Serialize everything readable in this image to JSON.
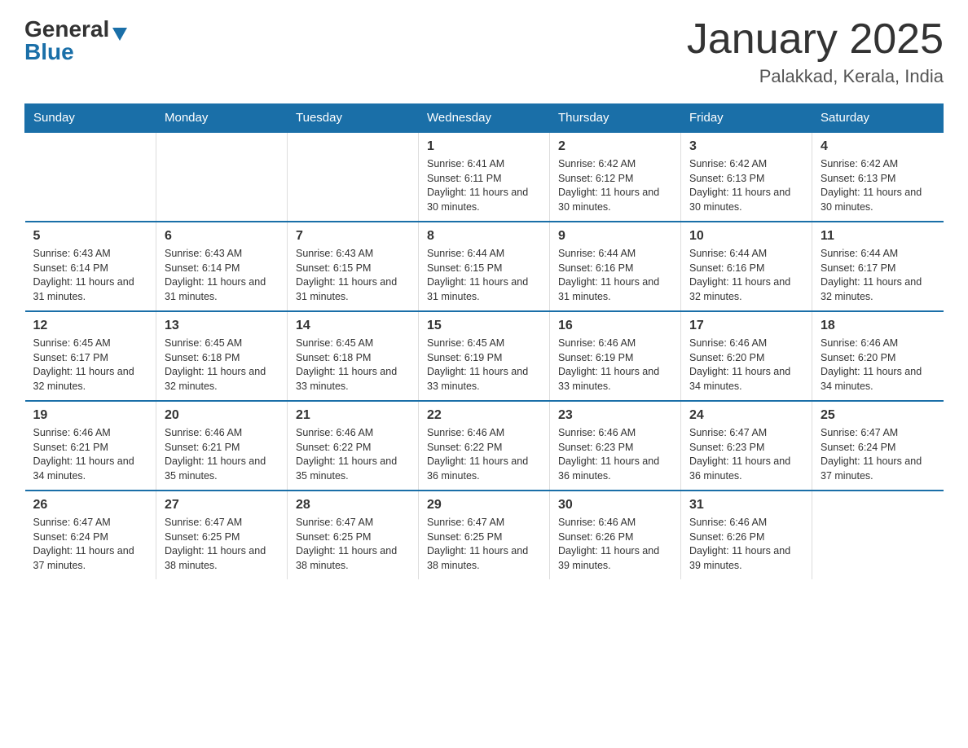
{
  "header": {
    "logo_general": "General",
    "logo_blue": "Blue",
    "title": "January 2025",
    "subtitle": "Palakkad, Kerala, India"
  },
  "days_of_week": [
    "Sunday",
    "Monday",
    "Tuesday",
    "Wednesday",
    "Thursday",
    "Friday",
    "Saturday"
  ],
  "weeks": [
    [
      {
        "day": "",
        "info": ""
      },
      {
        "day": "",
        "info": ""
      },
      {
        "day": "",
        "info": ""
      },
      {
        "day": "1",
        "info": "Sunrise: 6:41 AM\nSunset: 6:11 PM\nDaylight: 11 hours and 30 minutes."
      },
      {
        "day": "2",
        "info": "Sunrise: 6:42 AM\nSunset: 6:12 PM\nDaylight: 11 hours and 30 minutes."
      },
      {
        "day": "3",
        "info": "Sunrise: 6:42 AM\nSunset: 6:13 PM\nDaylight: 11 hours and 30 minutes."
      },
      {
        "day": "4",
        "info": "Sunrise: 6:42 AM\nSunset: 6:13 PM\nDaylight: 11 hours and 30 minutes."
      }
    ],
    [
      {
        "day": "5",
        "info": "Sunrise: 6:43 AM\nSunset: 6:14 PM\nDaylight: 11 hours and 31 minutes."
      },
      {
        "day": "6",
        "info": "Sunrise: 6:43 AM\nSunset: 6:14 PM\nDaylight: 11 hours and 31 minutes."
      },
      {
        "day": "7",
        "info": "Sunrise: 6:43 AM\nSunset: 6:15 PM\nDaylight: 11 hours and 31 minutes."
      },
      {
        "day": "8",
        "info": "Sunrise: 6:44 AM\nSunset: 6:15 PM\nDaylight: 11 hours and 31 minutes."
      },
      {
        "day": "9",
        "info": "Sunrise: 6:44 AM\nSunset: 6:16 PM\nDaylight: 11 hours and 31 minutes."
      },
      {
        "day": "10",
        "info": "Sunrise: 6:44 AM\nSunset: 6:16 PM\nDaylight: 11 hours and 32 minutes."
      },
      {
        "day": "11",
        "info": "Sunrise: 6:44 AM\nSunset: 6:17 PM\nDaylight: 11 hours and 32 minutes."
      }
    ],
    [
      {
        "day": "12",
        "info": "Sunrise: 6:45 AM\nSunset: 6:17 PM\nDaylight: 11 hours and 32 minutes."
      },
      {
        "day": "13",
        "info": "Sunrise: 6:45 AM\nSunset: 6:18 PM\nDaylight: 11 hours and 32 minutes."
      },
      {
        "day": "14",
        "info": "Sunrise: 6:45 AM\nSunset: 6:18 PM\nDaylight: 11 hours and 33 minutes."
      },
      {
        "day": "15",
        "info": "Sunrise: 6:45 AM\nSunset: 6:19 PM\nDaylight: 11 hours and 33 minutes."
      },
      {
        "day": "16",
        "info": "Sunrise: 6:46 AM\nSunset: 6:19 PM\nDaylight: 11 hours and 33 minutes."
      },
      {
        "day": "17",
        "info": "Sunrise: 6:46 AM\nSunset: 6:20 PM\nDaylight: 11 hours and 34 minutes."
      },
      {
        "day": "18",
        "info": "Sunrise: 6:46 AM\nSunset: 6:20 PM\nDaylight: 11 hours and 34 minutes."
      }
    ],
    [
      {
        "day": "19",
        "info": "Sunrise: 6:46 AM\nSunset: 6:21 PM\nDaylight: 11 hours and 34 minutes."
      },
      {
        "day": "20",
        "info": "Sunrise: 6:46 AM\nSunset: 6:21 PM\nDaylight: 11 hours and 35 minutes."
      },
      {
        "day": "21",
        "info": "Sunrise: 6:46 AM\nSunset: 6:22 PM\nDaylight: 11 hours and 35 minutes."
      },
      {
        "day": "22",
        "info": "Sunrise: 6:46 AM\nSunset: 6:22 PM\nDaylight: 11 hours and 36 minutes."
      },
      {
        "day": "23",
        "info": "Sunrise: 6:46 AM\nSunset: 6:23 PM\nDaylight: 11 hours and 36 minutes."
      },
      {
        "day": "24",
        "info": "Sunrise: 6:47 AM\nSunset: 6:23 PM\nDaylight: 11 hours and 36 minutes."
      },
      {
        "day": "25",
        "info": "Sunrise: 6:47 AM\nSunset: 6:24 PM\nDaylight: 11 hours and 37 minutes."
      }
    ],
    [
      {
        "day": "26",
        "info": "Sunrise: 6:47 AM\nSunset: 6:24 PM\nDaylight: 11 hours and 37 minutes."
      },
      {
        "day": "27",
        "info": "Sunrise: 6:47 AM\nSunset: 6:25 PM\nDaylight: 11 hours and 38 minutes."
      },
      {
        "day": "28",
        "info": "Sunrise: 6:47 AM\nSunset: 6:25 PM\nDaylight: 11 hours and 38 minutes."
      },
      {
        "day": "29",
        "info": "Sunrise: 6:47 AM\nSunset: 6:25 PM\nDaylight: 11 hours and 38 minutes."
      },
      {
        "day": "30",
        "info": "Sunrise: 6:46 AM\nSunset: 6:26 PM\nDaylight: 11 hours and 39 minutes."
      },
      {
        "day": "31",
        "info": "Sunrise: 6:46 AM\nSunset: 6:26 PM\nDaylight: 11 hours and 39 minutes."
      },
      {
        "day": "",
        "info": ""
      }
    ]
  ]
}
